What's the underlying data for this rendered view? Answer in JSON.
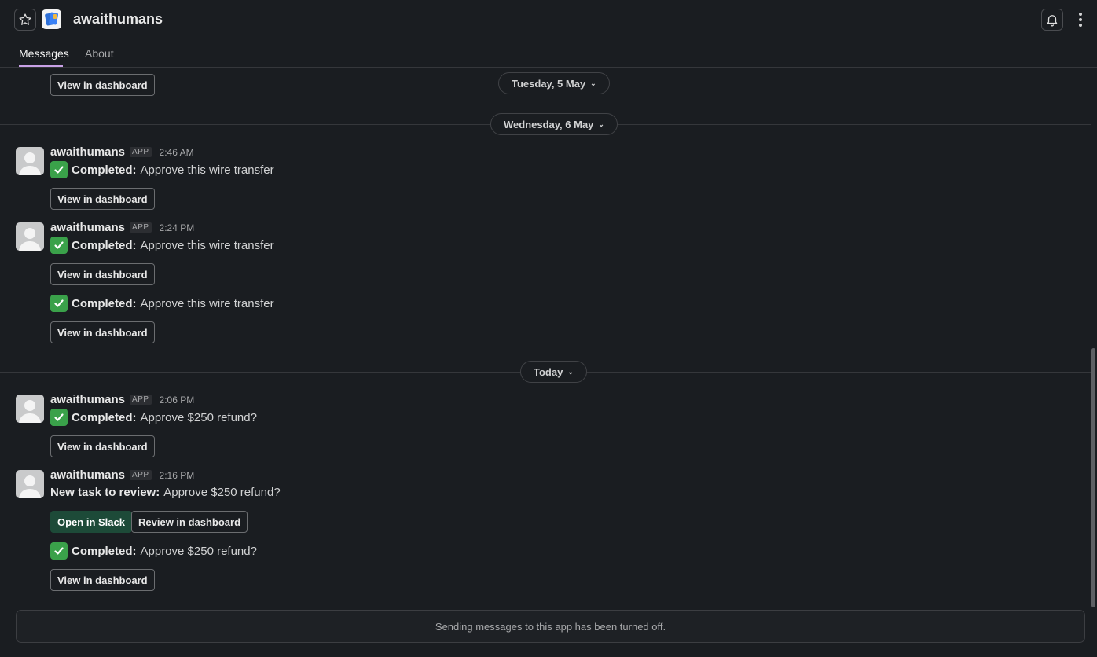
{
  "header": {
    "app_name": "awaithumans",
    "tabs": [
      {
        "label": "Messages",
        "active": true
      },
      {
        "label": "About",
        "active": false
      }
    ],
    "icons": [
      "star-icon",
      "app-logo",
      "bell-icon",
      "more-vertical-icon"
    ]
  },
  "dates": {
    "tuesday": "Tuesday, 5 May",
    "wednesday": "Wednesday, 6 May",
    "today": "Today"
  },
  "messages": {
    "top": {
      "button": "View in dashboard"
    },
    "m1": {
      "sender": "awaithumans",
      "badge": "APP",
      "time": "2:46 AM",
      "status": "Completed:",
      "text": "Approve this wire transfer",
      "button": "View in dashboard"
    },
    "m2": {
      "sender": "awaithumans",
      "badge": "APP",
      "time": "2:24 PM",
      "status": "Completed:",
      "text": "Approve this wire transfer",
      "button": "View in dashboard",
      "status2": "Completed:",
      "text2": "Approve this wire transfer",
      "button2": "View in dashboard"
    },
    "m3": {
      "sender": "awaithumans",
      "badge": "APP",
      "time": "2:06 PM",
      "status": "Completed:",
      "text": "Approve $250 refund?",
      "button": "View in dashboard"
    },
    "m4": {
      "sender": "awaithumans",
      "badge": "APP",
      "time": "2:16 PM",
      "status": "New task to review:",
      "text": "Approve $250 refund?",
      "button_primary": "Open in Slack",
      "button_secondary": "Review in dashboard",
      "status2": "Completed:",
      "text2": "Approve $250 refund?",
      "button2": "View in dashboard"
    }
  },
  "footer": {
    "notice": "Sending messages to this app has been turned off."
  },
  "colors": {
    "background": "#1a1d21",
    "accent_tab": "#c9a2e8",
    "primary_button": "#1d4a38",
    "check": "#3aa14a"
  }
}
